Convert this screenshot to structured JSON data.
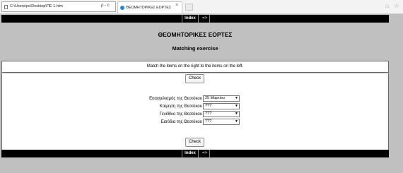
{
  "browser": {
    "address": "C:\\Users\\pc\\Desktop\\ΠΕ 1.htm",
    "address_tools": "ρ - c",
    "tab_title": "ΘΕΟΜΗΤΟΡΙΚΕΣ ΕΟΡΤΕΣ",
    "tab_close": "×",
    "home_icon": "home-icon",
    "star_icon": "star-icon"
  },
  "nav": {
    "index_label": "Index",
    "next_label": "=>"
  },
  "page": {
    "title": "ΘΕΟΜΗΤΟΡΙΚΕΣ ΕΟΡΤΕΣ",
    "subtitle": "Matching exercise",
    "instruction": "Match the items on the right to the items on the left.",
    "check_label": "Check"
  },
  "matches": [
    {
      "label": "Ευαγγελισμός της Θεοτόκου",
      "value": "25 Μαρτίου"
    },
    {
      "label": "Κοίμηση της Θεοτόκου",
      "value": "???"
    },
    {
      "label": "Γενέθλιο της Θεοτόκου",
      "value": "???"
    },
    {
      "label": "Εισόδια της Θεοτόκου",
      "value": "???"
    }
  ]
}
